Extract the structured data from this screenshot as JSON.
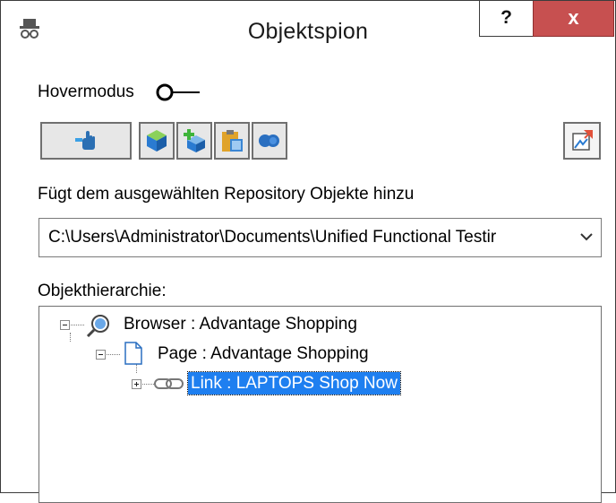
{
  "window": {
    "title": "Objektspion",
    "help_label": "?",
    "close_label": "x"
  },
  "hover": {
    "label": "Hovermodus",
    "enabled": false
  },
  "toolbar": {
    "buttons": [
      {
        "name": "hand-pointer-icon"
      },
      {
        "name": "object-cube-icon"
      },
      {
        "name": "add-object-icon"
      },
      {
        "name": "clipboard-icon"
      },
      {
        "name": "toggle-dots-icon"
      },
      {
        "name": "export-icon"
      }
    ]
  },
  "add_section": {
    "label": "Fügt dem ausgewählten Repository Objekte hinzu",
    "path_value": "C:\\Users\\Administrator\\Documents\\Unified Functional Testir"
  },
  "hierarchy": {
    "label": "Objekthierarchie:",
    "nodes": [
      {
        "label": "Browser : Advantage Shopping",
        "icon": "browser-icon",
        "expanded": true
      },
      {
        "label": "Page : Advantage Shopping",
        "icon": "page-icon",
        "expanded": true
      },
      {
        "label": "Link : LAPTOPS Shop Now",
        "icon": "link-icon",
        "expanded": false,
        "selected": true
      }
    ]
  },
  "colors": {
    "close_bg": "#c75050",
    "selection_bg": "#1e7ff0"
  }
}
